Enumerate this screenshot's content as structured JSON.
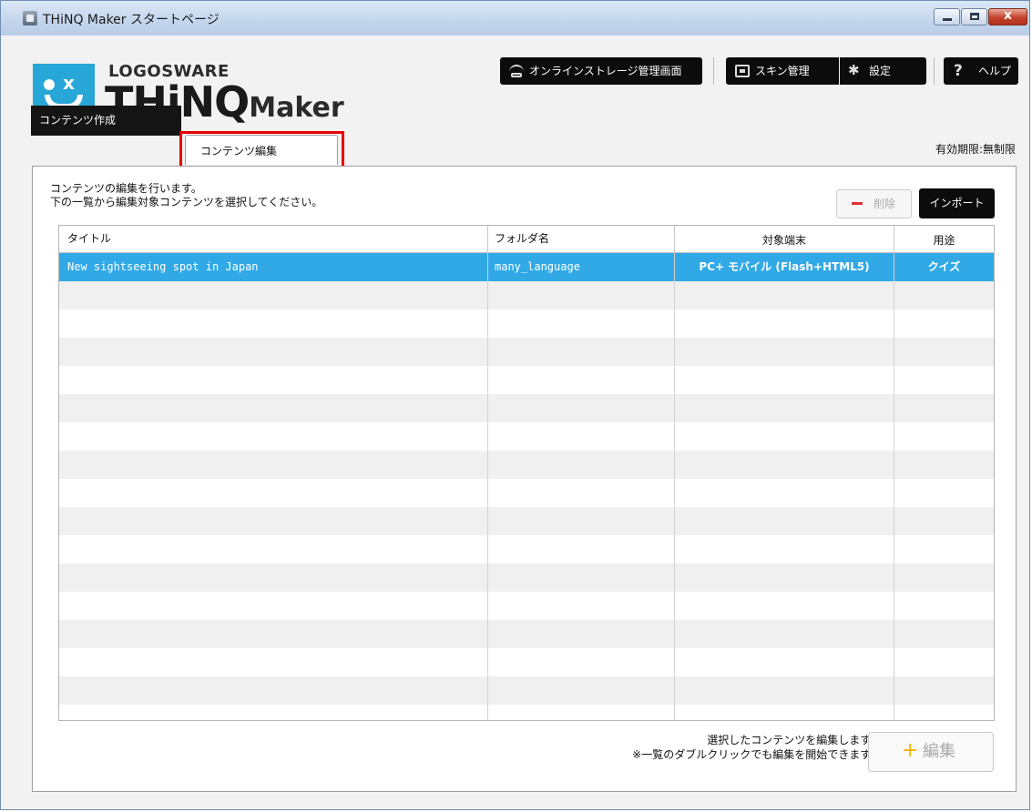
{
  "window": {
    "title": "THiNQ Maker スタートページ",
    "close_glyph": "x"
  },
  "logo": {
    "brand": "LOGOSWARE",
    "product": "THiNQ",
    "suffix": "Maker",
    "mark_symbol": "x",
    "color": "#27a6d8"
  },
  "header_buttons": {
    "storage": "オンラインストレージ管理画面",
    "skin": "スキン管理",
    "settings": "設定",
    "help": "ヘルプ",
    "help_symbol": "?"
  },
  "tabs": [
    {
      "label": "コンテンツ作成",
      "active": false
    },
    {
      "label": "コンテンツ編集",
      "active": true
    }
  ],
  "expiry": "有効期限:無制限",
  "main": {
    "desc_line1": "コンテンツの編集を行います。",
    "desc_line2": "下の一覧から編集対象コンテンツを選択してください。",
    "delete_label": "削除",
    "import_label": "インポート"
  },
  "table": {
    "columns": [
      "タイトル",
      "フォルダ名",
      "対象端末",
      "用途"
    ],
    "rows": [
      {
        "title": "New sightseeing spot in Japan",
        "folder": "many_language",
        "device": "PC+ モバイル (Flash+HTML5)",
        "purpose": "クイズ",
        "selected": true
      }
    ]
  },
  "footer": {
    "note_line1": "選択したコンテンツを編集します。",
    "note_line2": "※一覧のダブルクリックでも編集を開始できます。",
    "edit_label": "編集",
    "edit_symbol": "+"
  },
  "colors": {
    "selected_row": "#31a9e7",
    "tab_highlight": "#e60000",
    "dark_button": "#0c0c0c"
  }
}
